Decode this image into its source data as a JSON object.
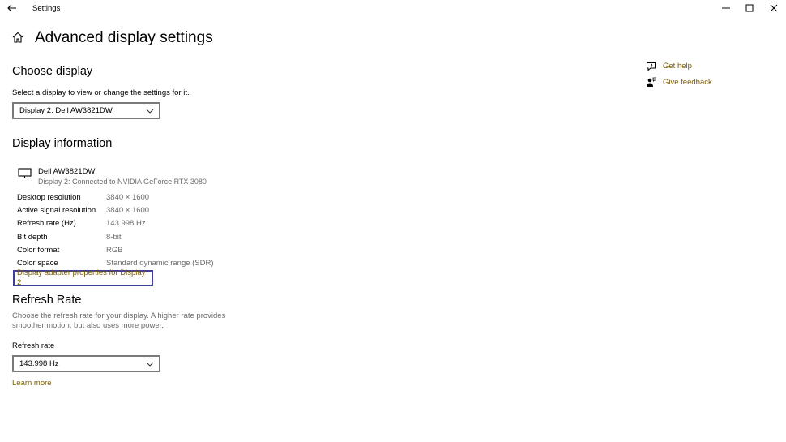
{
  "window": {
    "title": "Settings"
  },
  "page": {
    "title": "Advanced display settings"
  },
  "choose_display": {
    "heading": "Choose display",
    "description": "Select a display to view or change the settings for it.",
    "selected_display": "Display 2: Dell AW3821DW"
  },
  "display_information": {
    "heading": "Display information",
    "monitor_name": "Dell AW3821DW",
    "connection": "Display 2: Connected to NVIDIA GeForce RTX 3080",
    "rows": [
      {
        "label": "Desktop resolution",
        "value": "3840 × 1600"
      },
      {
        "label": "Active signal resolution",
        "value": "3840 × 1600"
      },
      {
        "label": "Refresh rate (Hz)",
        "value": "143.998 Hz"
      },
      {
        "label": "Bit depth",
        "value": "8-bit"
      },
      {
        "label": "Color format",
        "value": "RGB"
      },
      {
        "label": "Color space",
        "value": "Standard dynamic range (SDR)"
      }
    ],
    "adapter_link": "Display adapter properties for Display 2"
  },
  "refresh_rate": {
    "heading": "Refresh Rate",
    "description_line1": "Choose the refresh rate for your display. A higher rate provides",
    "description_line2": "smoother motion, but also uses more power.",
    "field_label": "Refresh rate",
    "selected_rate": "143.998 Hz",
    "learn_more": "Learn more"
  },
  "help": {
    "get_help": "Get help",
    "give_feedback": "Give feedback"
  },
  "colors": {
    "link": "#7a5c00",
    "focus_border": "#3f3f9a",
    "muted_text": "#6b6b6b"
  },
  "icons": [
    "back-arrow-icon",
    "minimize-icon",
    "maximize-icon",
    "close-icon",
    "home-icon",
    "monitor-icon",
    "chevron-down-icon",
    "help-chat-icon",
    "feedback-person-icon"
  ]
}
